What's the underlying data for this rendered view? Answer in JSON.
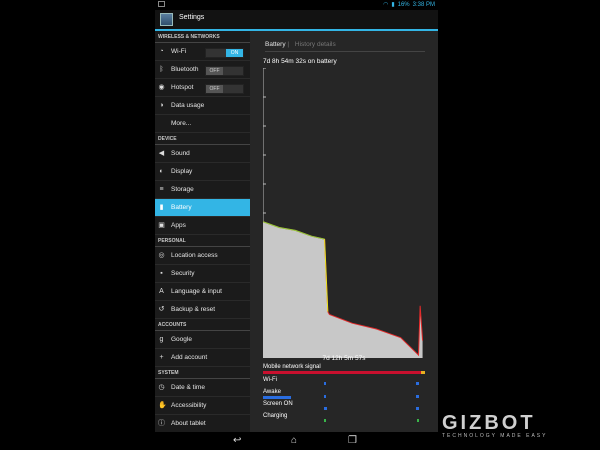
{
  "status_bar": {
    "battery_percent": "16%",
    "time": "3:38 PM"
  },
  "action_bar": {
    "title": "Settings"
  },
  "sidebar": {
    "sections": [
      {
        "header": "WIRELESS & NETWORKS",
        "items": [
          {
            "label": "Wi-Fi",
            "toggle": "ON"
          },
          {
            "label": "Bluetooth",
            "toggle": "OFF"
          },
          {
            "label": "Hotspot",
            "toggle": "OFF"
          },
          {
            "label": "Data usage"
          },
          {
            "label": "More..."
          }
        ]
      },
      {
        "header": "DEVICE",
        "items": [
          {
            "label": "Sound"
          },
          {
            "label": "Display"
          },
          {
            "label": "Storage"
          },
          {
            "label": "Battery"
          },
          {
            "label": "Apps"
          }
        ]
      },
      {
        "header": "PERSONAL",
        "items": [
          {
            "label": "Location access"
          },
          {
            "label": "Security"
          },
          {
            "label": "Language & input"
          },
          {
            "label": "Backup & reset"
          }
        ]
      },
      {
        "header": "ACCOUNTS",
        "items": [
          {
            "label": "Google"
          },
          {
            "label": "Add account"
          }
        ]
      },
      {
        "header": "SYSTEM",
        "items": [
          {
            "label": "Date & time"
          },
          {
            "label": "Accessibility"
          },
          {
            "label": "About tablet"
          }
        ]
      }
    ]
  },
  "battery": {
    "tabs": {
      "active": "Battery",
      "inactive": "History details"
    },
    "on_battery": "7d 8h 54m 32s on battery",
    "duration": "7d 12h 5m 57s",
    "signals": [
      "Mobile network signal",
      "Wi-Fi",
      "Awake",
      "Screen ON",
      "Charging"
    ]
  },
  "chart_data": {
    "type": "area",
    "title": "7d 8h 54m 32s on battery",
    "xlabel": "7d 12h 5m 57s",
    "ylim": [
      0,
      100
    ],
    "points": [
      {
        "t": 0.0,
        "level": 47
      },
      {
        "t": 0.1,
        "level": 45
      },
      {
        "t": 0.2,
        "level": 44
      },
      {
        "t": 0.3,
        "level": 42
      },
      {
        "t": 0.38,
        "level": 41
      },
      {
        "t": 0.4,
        "level": 16
      },
      {
        "t": 0.41,
        "level": 15
      },
      {
        "t": 0.55,
        "level": 12
      },
      {
        "t": 0.7,
        "level": 10
      },
      {
        "t": 0.85,
        "level": 7
      },
      {
        "t": 0.96,
        "level": 1
      },
      {
        "t": 0.97,
        "level": 18
      },
      {
        "t": 0.985,
        "level": 6
      }
    ],
    "colors": {
      "fill": "#c8c8c8",
      "high": "#8bd13a",
      "mid": "#e8e820",
      "low": "#e32b2b"
    }
  },
  "icons": {
    "wifi": "wifi-icon",
    "bluetooth": "bluetooth-icon",
    "hotspot": "hotspot-icon",
    "data": "data-usage-icon",
    "sound": "sound-icon",
    "display": "display-icon",
    "storage": "storage-icon",
    "battery": "battery-icon",
    "apps": "apps-icon",
    "location": "location-icon",
    "security": "lock-icon",
    "language": "language-icon",
    "backup": "backup-icon",
    "google": "google-icon",
    "add": "add-icon",
    "date": "clock-icon",
    "accessibility": "accessibility-icon",
    "about": "info-icon"
  },
  "navigation": {
    "back": "back",
    "home": "home",
    "recents": "recent-apps"
  },
  "watermark": {
    "logo": "GIZBOT",
    "tagline": "TECHNOLOGY MADE EASY"
  }
}
